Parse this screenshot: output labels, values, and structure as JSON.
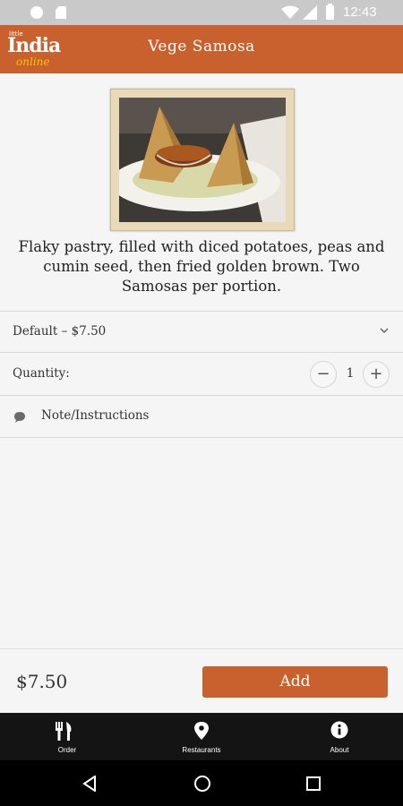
{
  "status_bar": {
    "time": "12:43",
    "icons": [
      "notification-dot-icon",
      "sd-card-icon",
      "wifi-icon",
      "signal-icon",
      "battery-icon"
    ]
  },
  "app_bar": {
    "logo": {
      "little": "little",
      "brand": "India",
      "online": "online"
    },
    "title": "Vege Samosa"
  },
  "item": {
    "image_alt": "samosa-photo",
    "description": "Flaky pastry, filled with diced potatoes, peas and cumin seed, then fried golden brown. Two Samosas per portion.",
    "variant": "Default – $7.50",
    "quantity_label": "Quantity:",
    "quantity": "1",
    "minus_label": "−",
    "plus_label": "+",
    "note_label": "Note/Instructions"
  },
  "footer": {
    "price": "$7.50",
    "add_label": "Add"
  },
  "tabs": [
    {
      "label": "Order",
      "icon": "fork-knife-icon"
    },
    {
      "label": "Restaurants",
      "icon": "map-pin-icon"
    },
    {
      "label": "About",
      "icon": "info-icon"
    }
  ],
  "colors": {
    "brand": "#c8612d",
    "logo_accent": "#f3c400",
    "tab_bar": "#141414"
  }
}
